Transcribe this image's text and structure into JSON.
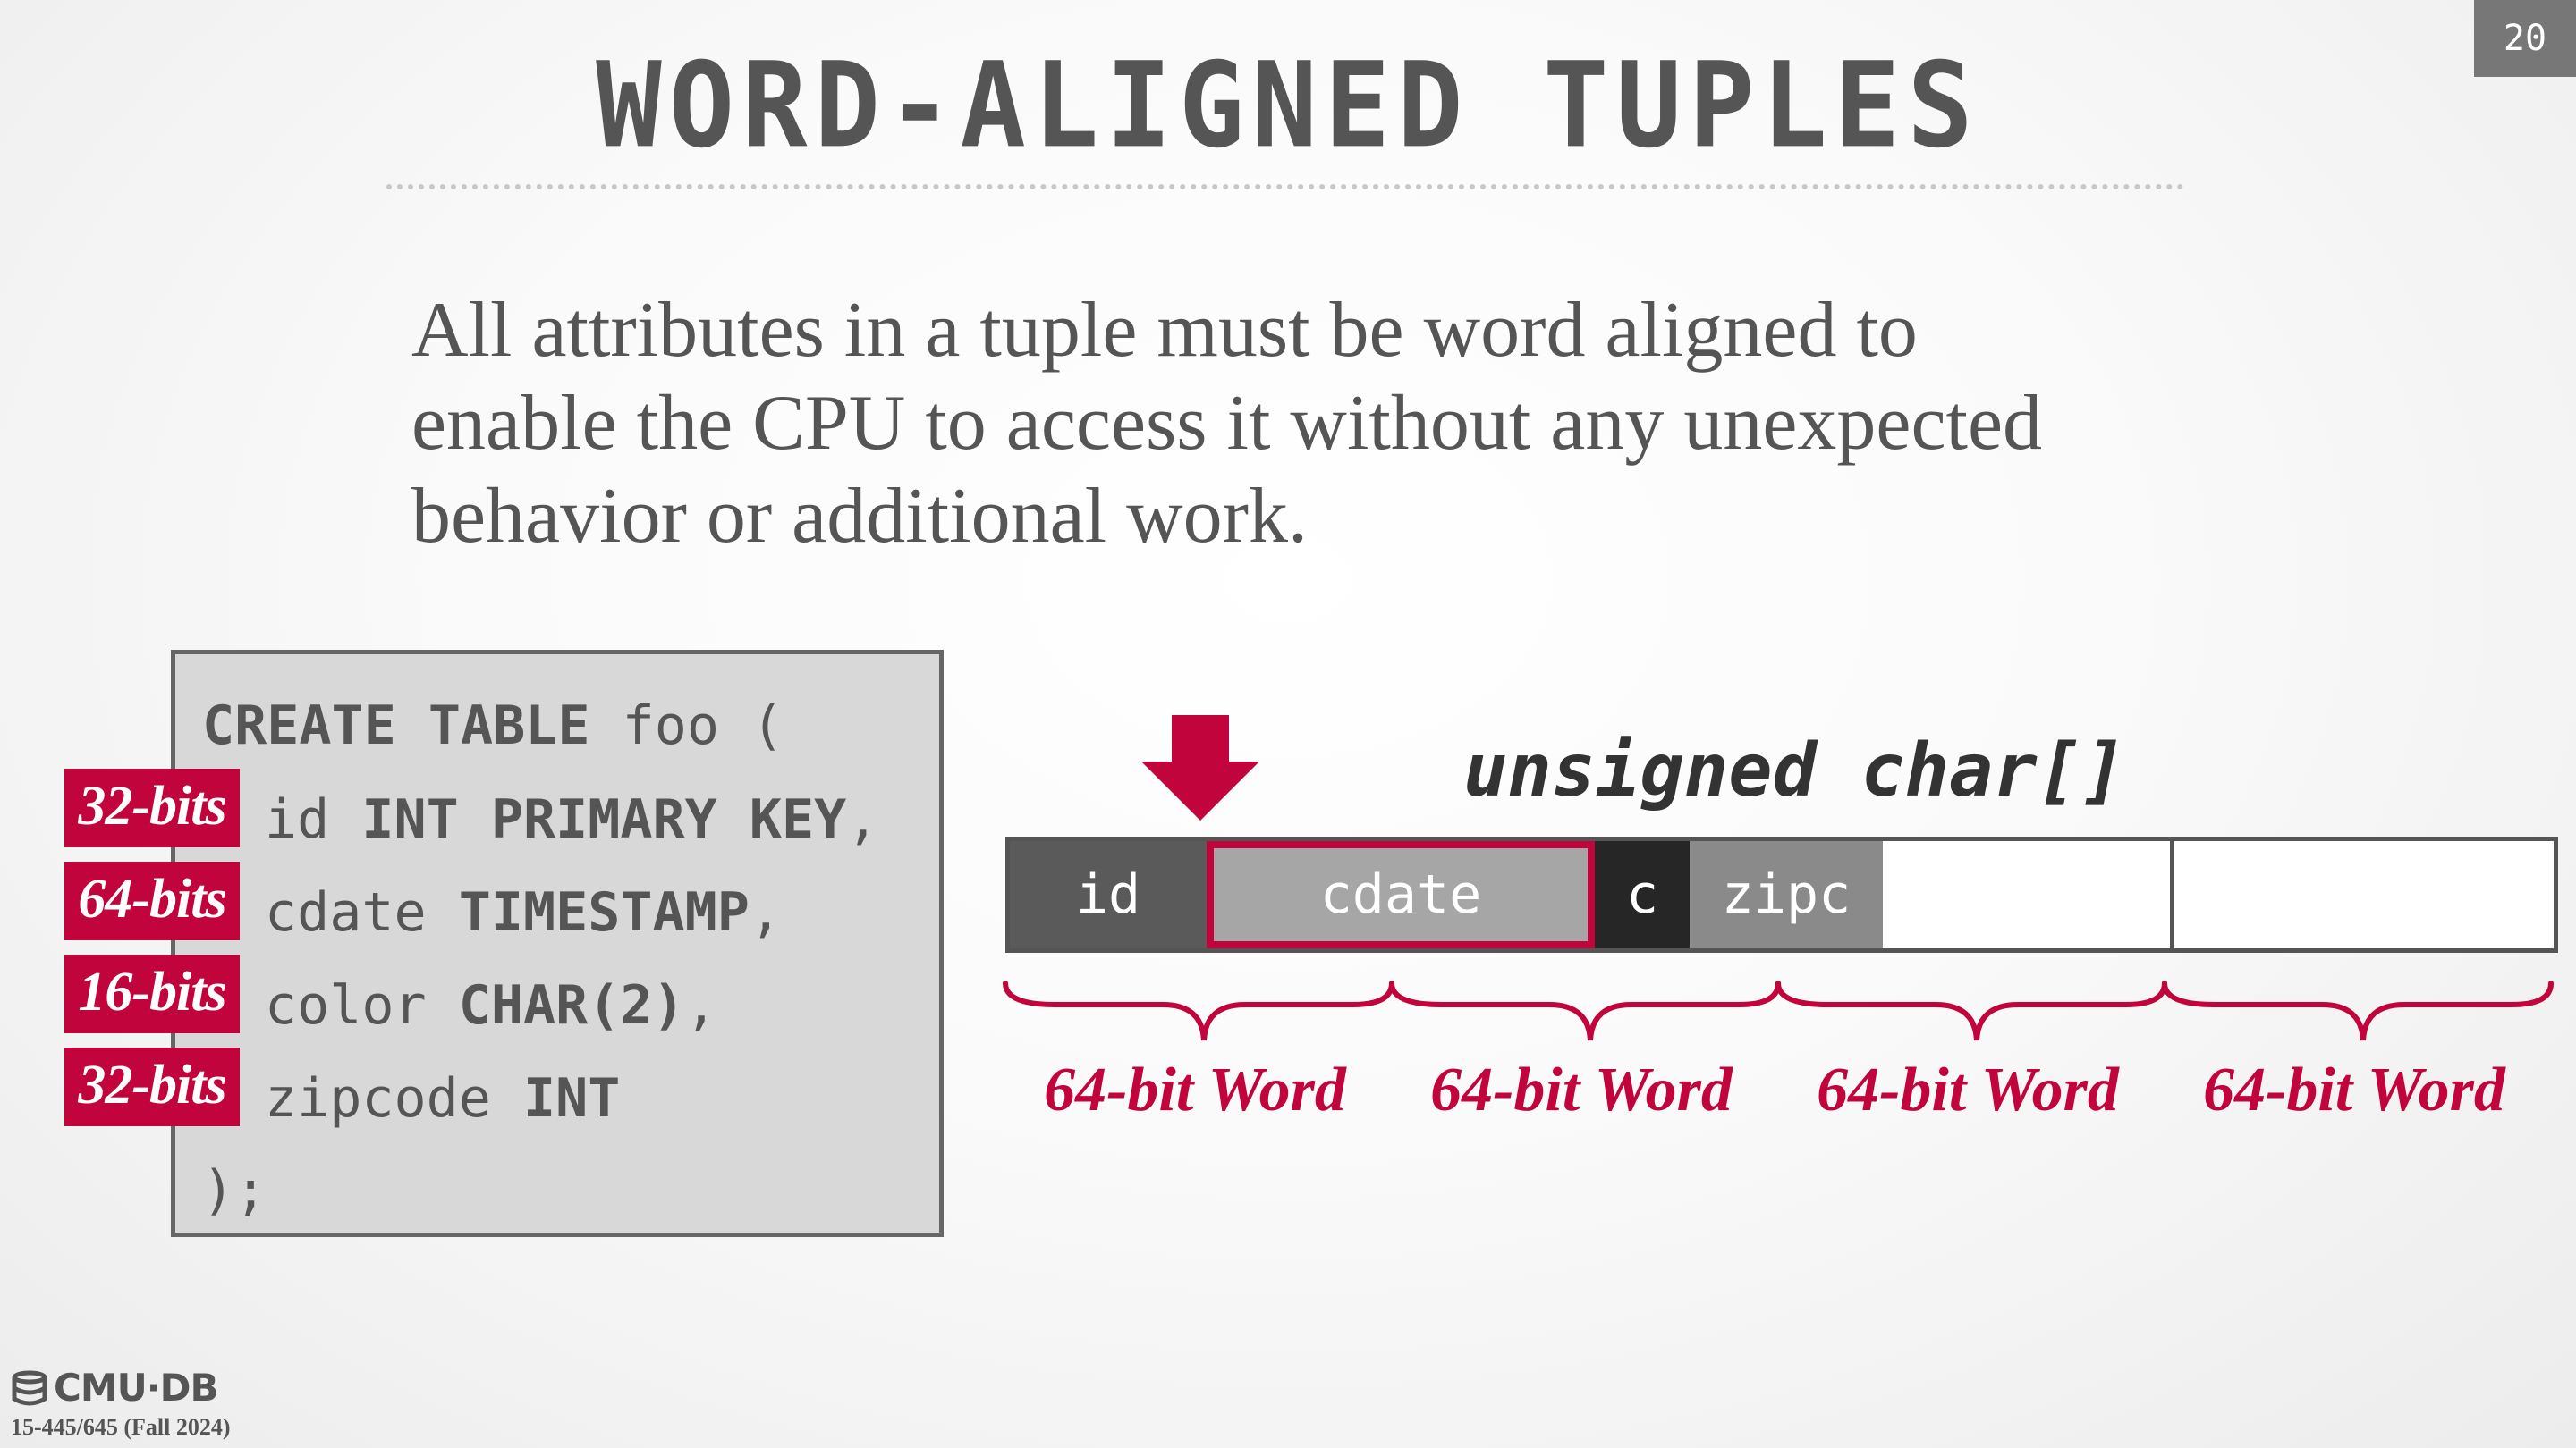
{
  "slide": {
    "page_number": "20",
    "title": "WORD-ALIGNED TUPLES",
    "body_lines": [
      "All attributes in a tuple must be word aligned to",
      "enable the CPU to access it without any unexpected",
      "behavior or additional work."
    ]
  },
  "sql": {
    "line0": {
      "kw1": "CREATE TABLE",
      "name": " foo ("
    },
    "line1": {
      "col": "id ",
      "type": "INT PRIMARY KEY",
      "tail": ","
    },
    "line2": {
      "col": "cdate ",
      "type": "TIMESTAMP",
      "tail": ","
    },
    "line3": {
      "col": "color ",
      "type": "CHAR(2)",
      "tail": ","
    },
    "line4": {
      "col": "zipcode ",
      "type": "INT",
      "tail": ""
    },
    "line5": ");"
  },
  "bit_badges": [
    "32-bits",
    "64-bits",
    "16-bits",
    "32-bits"
  ],
  "diagram": {
    "type_label": "unsigned char[]",
    "cells": [
      "id",
      "cdate",
      "c",
      "zipc",
      "",
      ""
    ],
    "word_labels": [
      "64-bit Word",
      "64-bit Word",
      "64-bit Word",
      "64-bit Word"
    ],
    "accent_color": "#c1053c"
  },
  "footer": {
    "logo_text": "CMU·DB",
    "course": "15-445/645 (Fall 2024)"
  }
}
